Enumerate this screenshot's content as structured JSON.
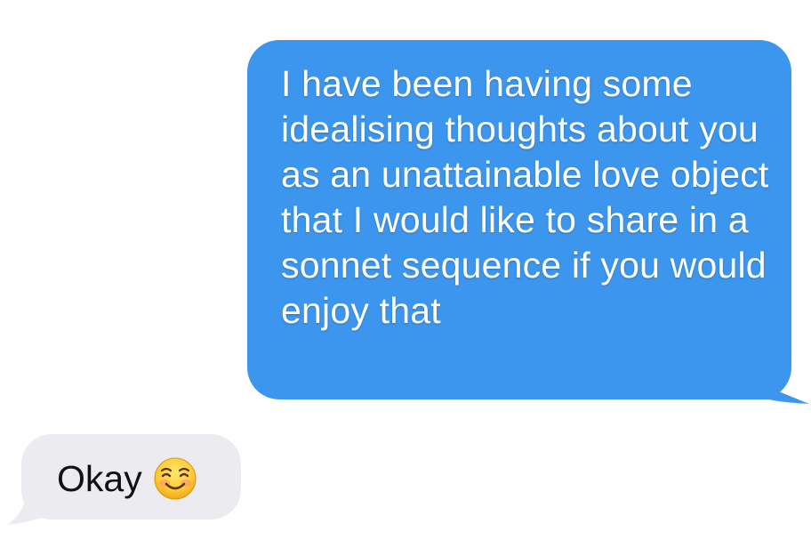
{
  "conversation": {
    "sent_message": {
      "text": "I have been having some idealising thoughts about you as an unattainable love object that I would like to share in a sonnet sequence if you would enjoy that",
      "bubble_color": "#3d96ee",
      "text_color": "#ffffff"
    },
    "received_message": {
      "text": "Okay",
      "emoji": "smiling-face-with-smiling-eyes",
      "bubble_color": "#ebebf0",
      "text_color": "#111111"
    }
  }
}
